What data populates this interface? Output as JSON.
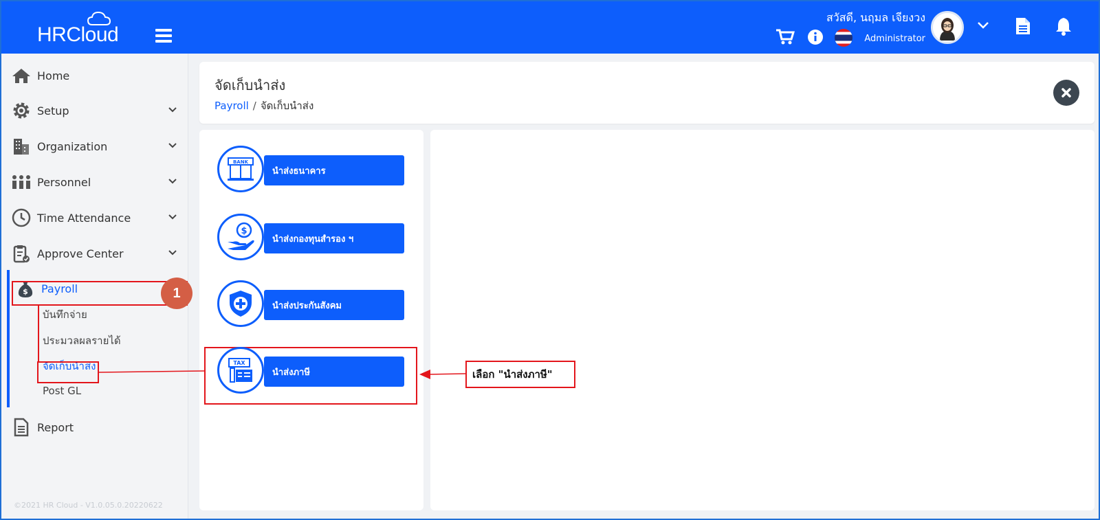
{
  "header": {
    "logo_text": "HRCloud",
    "greeting": "สวัสดี, นฤมล เจียงวง",
    "role": "Administrator"
  },
  "sidebar": {
    "items": [
      {
        "label": "Home",
        "icon": "home-icon"
      },
      {
        "label": "Setup",
        "icon": "gear-icon"
      },
      {
        "label": "Organization",
        "icon": "building-icon"
      },
      {
        "label": "Personnel",
        "icon": "people-icon"
      },
      {
        "label": "Time Attendance",
        "icon": "clock-icon"
      },
      {
        "label": "Approve Center",
        "icon": "clipboard-check-icon"
      },
      {
        "label": "Payroll",
        "icon": "money-bag-icon"
      },
      {
        "label": "Report",
        "icon": "document-icon"
      }
    ],
    "payroll_sub": [
      {
        "label": "บันทึกจ่าย"
      },
      {
        "label": "ประมวลผลรายได้"
      },
      {
        "label": "จัดเก็บนำส่ง"
      },
      {
        "label": "Post GL"
      }
    ],
    "copyright": "©2021 HR Cloud - V1.0.05.0.20220622"
  },
  "page": {
    "title": "จัดเก็บนำส่ง",
    "breadcrumb_link": "Payroll",
    "breadcrumb_separator": "/",
    "breadcrumb_current": "จัดเก็บนำส่ง"
  },
  "menu": [
    {
      "label": "นำส่งธนาคาร",
      "icon": "bank-icon"
    },
    {
      "label": "นำส่งกองทุนสำรอง ฯ",
      "icon": "fund-hand-icon"
    },
    {
      "label": "นำส่งประกันสังคม",
      "icon": "shield-plus-icon"
    },
    {
      "label": "นำส่งภาษี",
      "icon": "tax-icon"
    }
  ],
  "annotations": {
    "step_badge": "1",
    "callout": "เลือก \"นำส่งภาษี\""
  },
  "colors": {
    "primary": "#0d5efc",
    "annotation_red": "#e3151b",
    "badge": "#d45e45"
  }
}
